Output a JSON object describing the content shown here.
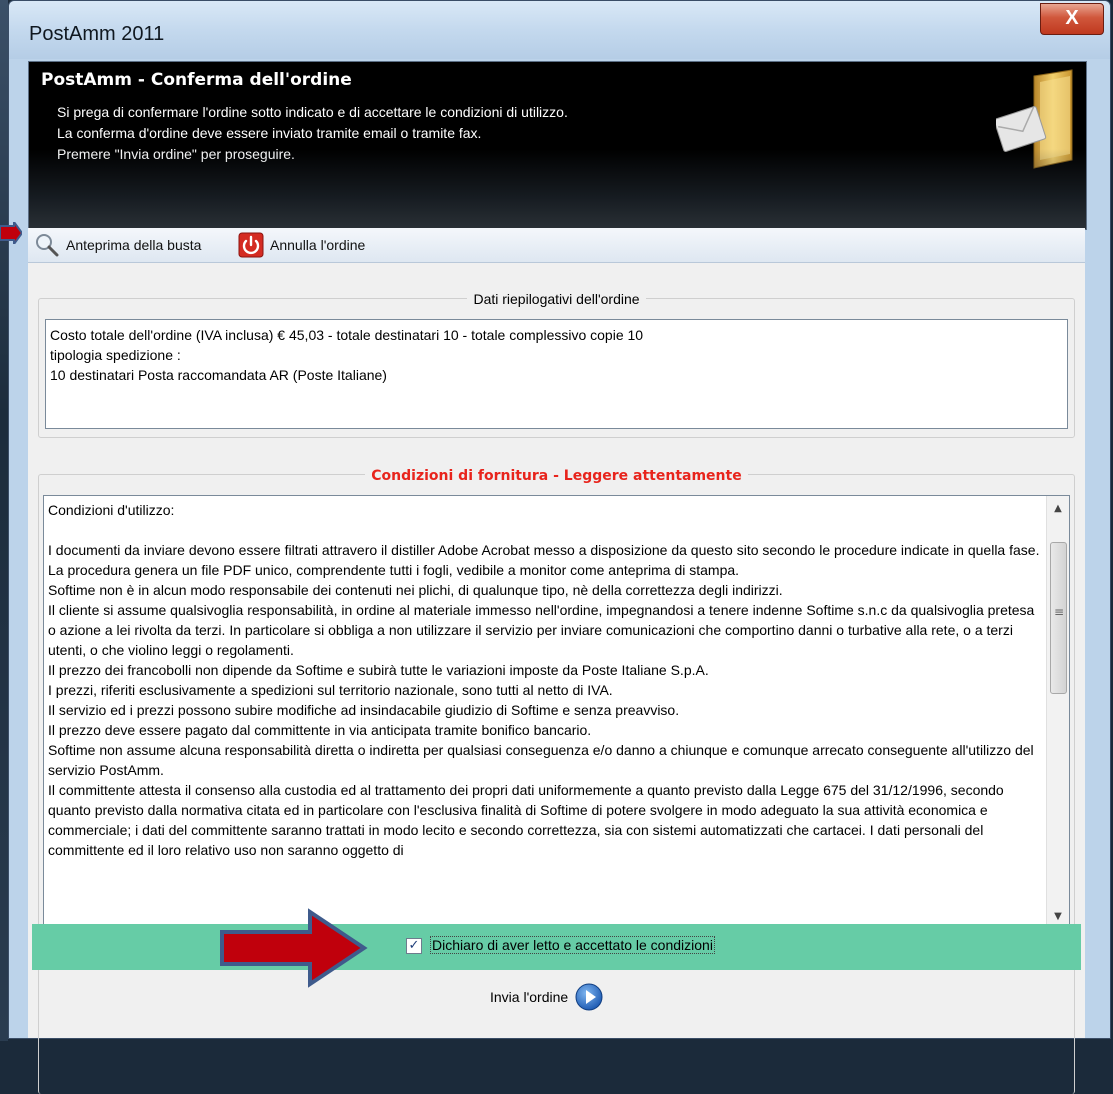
{
  "window": {
    "title": "PostAmm 2011",
    "close_glyph": "X"
  },
  "header": {
    "title": "PostAmm - Conferma dell'ordine",
    "lines": [
      "Si prega di confermare l'ordine sotto indicato e di accettare le condizioni di utilizzo.",
      "La conferma d'ordine deve essere inviato tramite email o tramite fax.",
      "Premere \"Invia ordine\" per proseguire."
    ],
    "icon": "folder-envelope-icon"
  },
  "toolbar": {
    "preview_label": "Anteprima della busta",
    "preview_icon": "magnifier-icon",
    "cancel_label": "Annulla l'ordine",
    "cancel_icon": "power-icon"
  },
  "summary": {
    "legend": "Dati riepilogativi dell'ordine",
    "lines": [
      "Costo totale dell'ordine (IVA inclusa) € 45,03 - totale destinatari 10 - totale complessivo copie 10",
      "tipologia spedizione :",
      "10 destinatari Posta raccomandata AR (Poste Italiane)"
    ]
  },
  "conditions": {
    "legend": "Condizioni di fornitura - Leggere attentamente",
    "legend_color": "#e8241c",
    "paragraphs": [
      "Condizioni d'utilizzo:",
      "",
      "I documenti da inviare devono essere filtrati attravero il distiller Adobe Acrobat messo a disposizione da questo sito secondo le procedure indicate in quella fase.",
      "La procedura genera un file PDF unico, comprendente tutti i fogli, vedibile a monitor come anteprima di stampa.",
      "Softime non è in alcun modo responsabile dei contenuti nei plichi, di qualunque tipo, nè della correttezza degli indirizzi.",
      "Il cliente si assume qualsivoglia responsabilità, in ordine al materiale immesso nell'ordine, impegnandosi a tenere indenne Softime s.n.c da qualsivoglia pretesa o azione a lei rivolta da terzi. In particolare si obbliga a non utilizzare il servizio per inviare comunicazioni che comportino danni o turbative alla rete, o a terzi utenti, o che violino leggi o regolamenti.",
      "Il prezzo dei francobolli non dipende da Softime e subirà tutte le variazioni imposte da Poste Italiane S.p.A.",
      "I prezzi, riferiti esclusivamente a spedizioni sul territorio nazionale, sono tutti al netto di IVA.",
      "Il servizio ed i prezzi possono subire modifiche ad insindacabile giudizio di Softime e senza preavviso.",
      "Il prezzo deve essere pagato dal committente in via anticipata tramite bonifico bancario.",
      "Softime non assume alcuna responsabilità diretta o indiretta per qualsiasi conseguenza e/o danno a chiunque e comunque arrecato conseguente all'utilizzo del servizio PostAmm.",
      "Il committente attesta il consenso alla custodia ed al trattamento dei propri dati uniformemente a quanto previsto dalla Legge 675 del 31/12/1996, secondo quanto previsto dalla normativa citata ed in particolare con l'esclusiva finalità di Softime di potere svolgere in modo adeguato la sua attività economica e commerciale; i dati del committente saranno trattati in modo lecito e secondo correttezza, sia con sistemi automatizzati che cartacei. I dati personali del committente ed il loro relativo uso non saranno oggetto di"
    ],
    "scrollbar_grip": "≡"
  },
  "accept": {
    "checked": true,
    "label": "Dichiaro di aver letto e accettato le condizioni",
    "bar_color": "#66cca6"
  },
  "send": {
    "label": "Invia l'ordine",
    "icon": "play-circle-icon"
  },
  "annotations": {
    "arrow_color": "#c0000c",
    "arrow_outline": "#3f5b8c"
  }
}
